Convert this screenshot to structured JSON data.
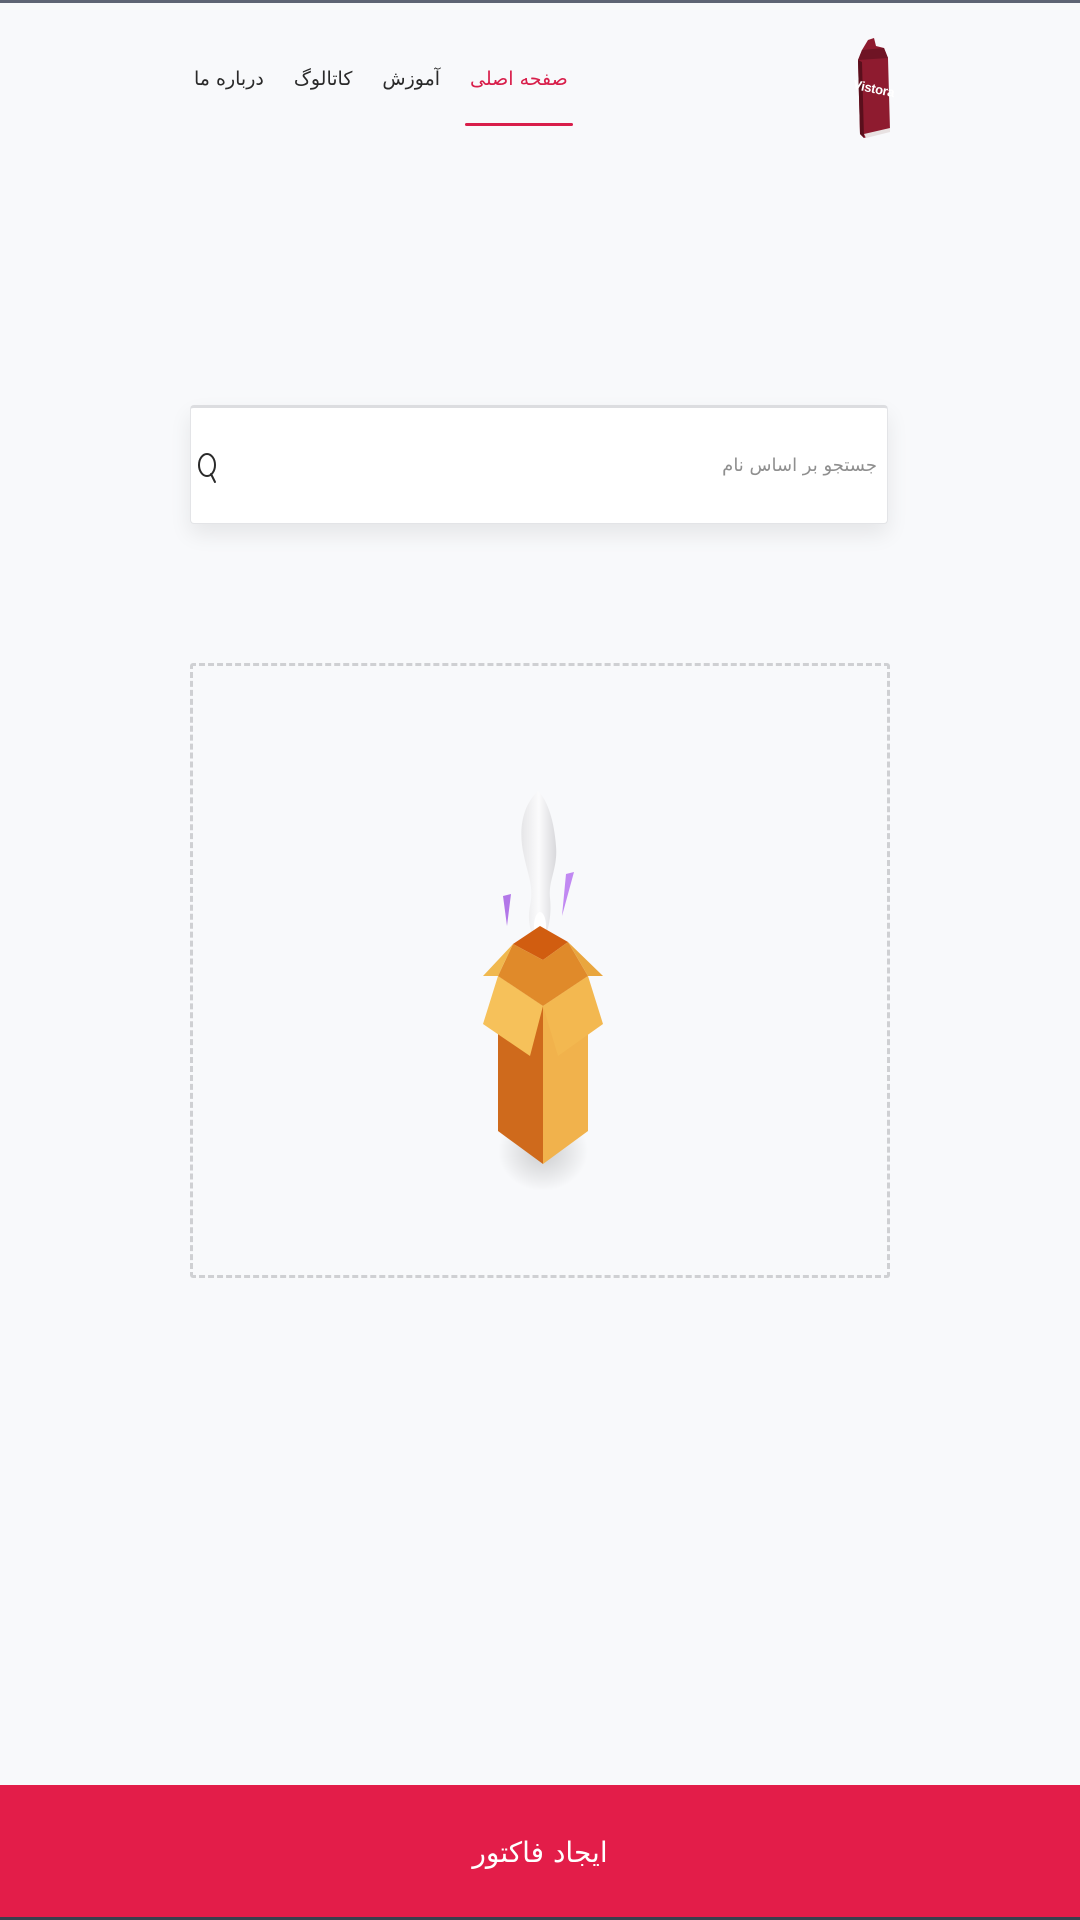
{
  "brand": {
    "logo_text": "Vistora",
    "logo_color": "#8e1b2f"
  },
  "nav": {
    "items": [
      {
        "label": "درباره ما",
        "active": false
      },
      {
        "label": "کاتالوگ",
        "active": false
      },
      {
        "label": "آموزش",
        "active": false
      },
      {
        "label": "صفحه اصلی",
        "active": true
      }
    ],
    "active_color": "#d81e4a"
  },
  "search": {
    "placeholder": "جستجو بر اساس نام",
    "value": "",
    "icon": "search-icon"
  },
  "empty_state": {
    "illustration": "open-box-icon"
  },
  "footer": {
    "create_invoice_label": "ایجاد فاکتور",
    "button_color": "#e31d49"
  }
}
